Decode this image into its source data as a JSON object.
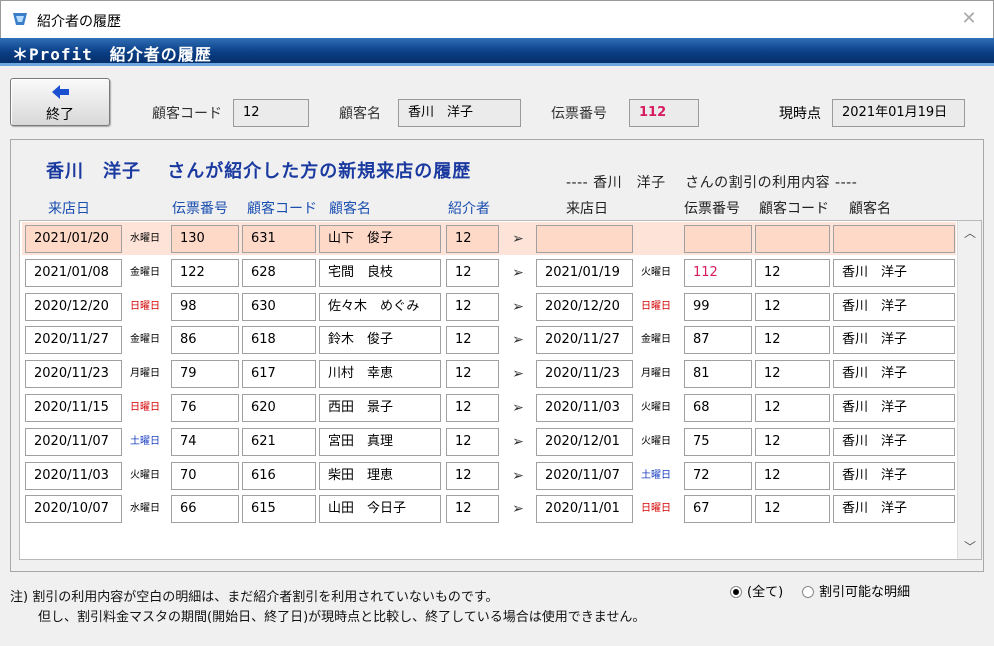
{
  "window": {
    "title": "紹介者の履歴",
    "banner": "＊Profit　紹介者の履歴"
  },
  "toolbar": {
    "exit_label": "終了"
  },
  "header": {
    "customer_code_label": "顧客コード",
    "customer_code": "12",
    "customer_name_label": "顧客名",
    "customer_name": "香川　洋子",
    "slip_label": "伝票番号",
    "slip_no": "112",
    "asof_label": "現時点",
    "asof_date": "2021年01月19日"
  },
  "section": {
    "heading": "香川　洋子　 さんが紹介した方の新規来店の履歴",
    "subheading": "---- 香川　洋子　 さんの割引の利用内容 ----"
  },
  "columns": {
    "visit_date": "来店日",
    "slip_no": "伝票番号",
    "customer_code": "顧客コード",
    "customer_name": "顧客名",
    "introducer": "紹介者",
    "r_visit_date": "来店日",
    "r_slip_no": "伝票番号",
    "r_customer_code": "顧客コード",
    "r_customer_name": "顧客名"
  },
  "rows": [
    {
      "date": "2021/01/20",
      "dow": "水曜日",
      "slip": "130",
      "code": "631",
      "name": "山下　俊子",
      "intro": "12",
      "arrow": "➢",
      "rdate": "",
      "rdow": "",
      "rslip": "",
      "rcode": "",
      "rname": ""
    },
    {
      "date": "2021/01/08",
      "dow": "金曜日",
      "slip": "122",
      "code": "628",
      "name": "宅間　良枝",
      "intro": "12",
      "arrow": "➢",
      "rdate": "2021/01/19",
      "rdow": "火曜日",
      "rslip": "112",
      "rcode": "12",
      "rname": "香川　洋子"
    },
    {
      "date": "2020/12/20",
      "dow": "日曜日",
      "slip": "98",
      "code": "630",
      "name": "佐々木　めぐみ",
      "intro": "12",
      "arrow": "➢",
      "rdate": "2020/12/20",
      "rdow": "日曜日",
      "rslip": "99",
      "rcode": "12",
      "rname": "香川　洋子"
    },
    {
      "date": "2020/11/27",
      "dow": "金曜日",
      "slip": "86",
      "code": "618",
      "name": "鈴木　俊子",
      "intro": "12",
      "arrow": "➢",
      "rdate": "2020/11/27",
      "rdow": "金曜日",
      "rslip": "87",
      "rcode": "12",
      "rname": "香川　洋子"
    },
    {
      "date": "2020/11/23",
      "dow": "月曜日",
      "slip": "79",
      "code": "617",
      "name": "川村　幸恵",
      "intro": "12",
      "arrow": "➢",
      "rdate": "2020/11/23",
      "rdow": "月曜日",
      "rslip": "81",
      "rcode": "12",
      "rname": "香川　洋子"
    },
    {
      "date": "2020/11/15",
      "dow": "日曜日",
      "slip": "76",
      "code": "620",
      "name": "西田　景子",
      "intro": "12",
      "arrow": "➢",
      "rdate": "2020/11/03",
      "rdow": "火曜日",
      "rslip": "68",
      "rcode": "12",
      "rname": "香川　洋子"
    },
    {
      "date": "2020/11/07",
      "dow": "土曜日",
      "slip": "74",
      "code": "621",
      "name": "宮田　真理",
      "intro": "12",
      "arrow": "➢",
      "rdate": "2020/12/01",
      "rdow": "火曜日",
      "rslip": "75",
      "rcode": "12",
      "rname": "香川　洋子"
    },
    {
      "date": "2020/11/03",
      "dow": "火曜日",
      "slip": "70",
      "code": "616",
      "name": "柴田　理恵",
      "intro": "12",
      "arrow": "➢",
      "rdate": "2020/11/07",
      "rdow": "土曜日",
      "rslip": "72",
      "rcode": "12",
      "rname": "香川　洋子"
    },
    {
      "date": "2020/10/07",
      "dow": "水曜日",
      "slip": "66",
      "code": "615",
      "name": "山田　今日子",
      "intro": "12",
      "arrow": "➢",
      "rdate": "2020/11/01",
      "rdow": "日曜日",
      "rslip": "67",
      "rcode": "12",
      "rname": "香川　洋子"
    }
  ],
  "notes": {
    "line1": "注) 割引の利用内容が空白の明細は、まだ紹介者割引を利用されていないものです。",
    "line2": "但し、割引料金マスタの期間(開始日、終了日)が現時点と比較し、終了している場合は使用できません。"
  },
  "filter": {
    "all_label": "(全て)",
    "discountable_label": "割引可能な明細",
    "selected": "all"
  },
  "colors": {
    "banner": "#0b3f86",
    "heading": "#1a3aa0",
    "selected_row": "#ffd9c8",
    "sunday": "#d40000",
    "saturday": "#1a40c0",
    "slip_highlight": "#d81b60"
  }
}
